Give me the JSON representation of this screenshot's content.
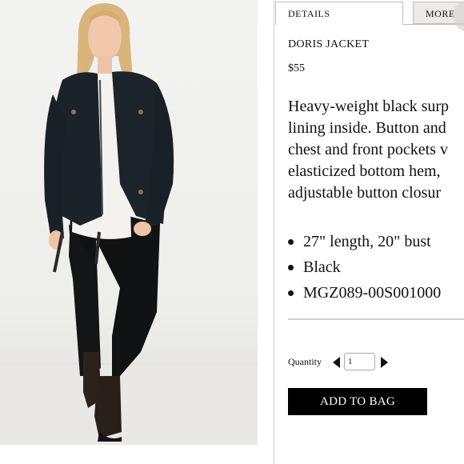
{
  "tabs": [
    {
      "label": "DETAILS",
      "active": true
    },
    {
      "label": "MORE",
      "active": false
    }
  ],
  "product": {
    "name": "DORIS JACKET",
    "price": "$55",
    "description_lines": [
      "Heavy-weight black surp",
      "lining inside. Button and",
      "chest and front pockets v",
      "elasticized bottom hem,",
      "adjustable button closur"
    ],
    "bullets": [
      "27\" length, 20\" bust",
      "Black",
      "MGZ089-00S001000"
    ]
  },
  "quantity": {
    "label": "Quantity",
    "value": "1"
  },
  "add_to_bag_label": "ADD TO BAG",
  "colors": {
    "button_bg": "#000000",
    "inactive_tab_bg": "#eee9e6",
    "divider": "#d8cfc9"
  }
}
